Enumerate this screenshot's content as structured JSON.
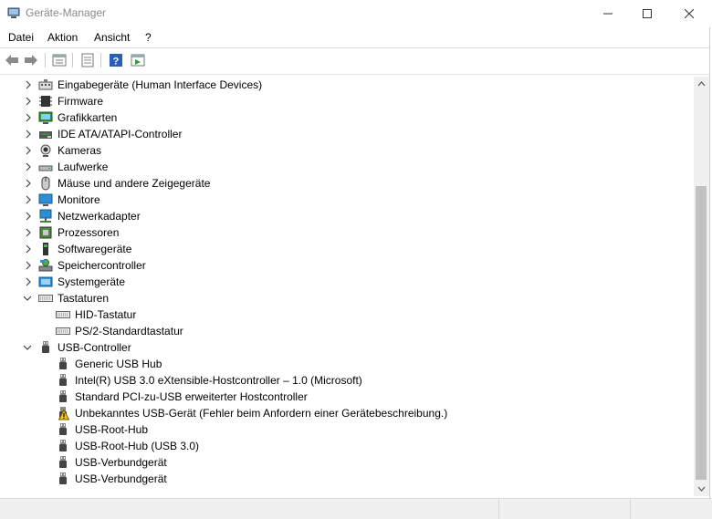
{
  "window": {
    "title": "Geräte-Manager"
  },
  "menu": [
    {
      "label": "Datei"
    },
    {
      "label": "Aktion"
    },
    {
      "label": "Ansicht"
    },
    {
      "label": "?"
    }
  ],
  "tree": {
    "categories": [
      {
        "label": "Eingabegeräte (Human Interface Devices)",
        "icon": "hid-icon",
        "expanded": false
      },
      {
        "label": "Firmware",
        "icon": "firmware-icon",
        "expanded": false
      },
      {
        "label": "Grafikkarten",
        "icon": "display-adapter-icon",
        "expanded": false
      },
      {
        "label": "IDE ATA/ATAPI-Controller",
        "icon": "ide-controller-icon",
        "expanded": false
      },
      {
        "label": "Kameras",
        "icon": "camera-icon",
        "expanded": false
      },
      {
        "label": "Laufwerke",
        "icon": "disk-drive-icon",
        "expanded": false
      },
      {
        "label": "Mäuse und andere Zeigegeräte",
        "icon": "mouse-icon",
        "expanded": false
      },
      {
        "label": "Monitore",
        "icon": "monitor-icon",
        "expanded": false
      },
      {
        "label": "Netzwerkadapter",
        "icon": "network-adapter-icon",
        "expanded": false
      },
      {
        "label": "Prozessoren",
        "icon": "processor-icon",
        "expanded": false
      },
      {
        "label": "Softwaregeräte",
        "icon": "software-device-icon",
        "expanded": false
      },
      {
        "label": "Speichercontroller",
        "icon": "storage-controller-icon",
        "expanded": false
      },
      {
        "label": "Systemgeräte",
        "icon": "system-device-icon",
        "expanded": false
      },
      {
        "label": "Tastaturen",
        "icon": "keyboard-icon",
        "expanded": true,
        "children": [
          {
            "label": "HID-Tastatur",
            "icon": "keyboard-icon"
          },
          {
            "label": "PS/2-Standardtastatur",
            "icon": "keyboard-icon"
          }
        ]
      },
      {
        "label": "USB-Controller",
        "icon": "usb-icon",
        "expanded": true,
        "children": [
          {
            "label": "Generic USB Hub",
            "icon": "usb-icon"
          },
          {
            "label": "Intel(R) USB 3.0 eXtensible-Hostcontroller – 1.0 (Microsoft)",
            "icon": "usb-icon"
          },
          {
            "label": "Standard PCI-zu-USB erweiterter Hostcontroller",
            "icon": "usb-icon"
          },
          {
            "label": "Unbekanntes USB-Gerät (Fehler beim Anfordern einer Gerätebeschreibung.)",
            "icon": "warning-icon"
          },
          {
            "label": "USB-Root-Hub",
            "icon": "usb-icon"
          },
          {
            "label": "USB-Root-Hub (USB 3.0)",
            "icon": "usb-icon"
          },
          {
            "label": "USB-Verbundgerät",
            "icon": "usb-icon"
          },
          {
            "label": "USB-Verbundgerät",
            "icon": "usb-icon"
          }
        ]
      }
    ]
  }
}
